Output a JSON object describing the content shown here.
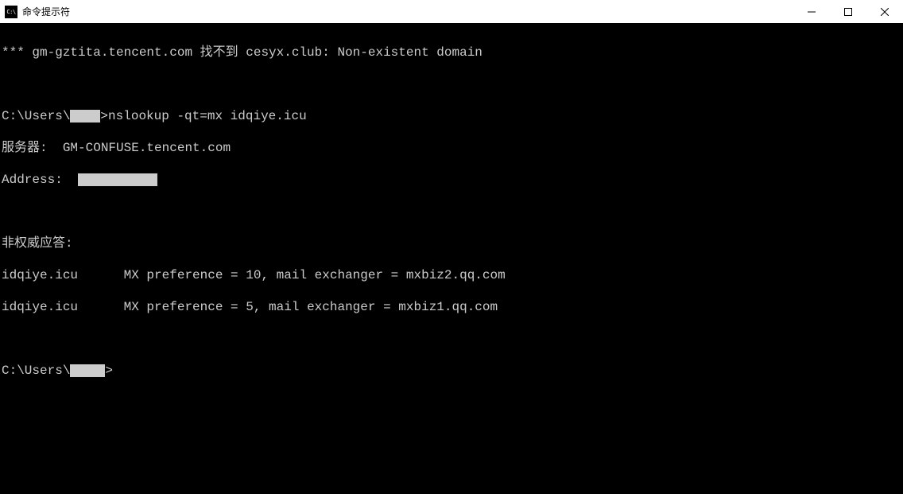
{
  "window": {
    "title": "命令提示符",
    "icon_text": "C:\\"
  },
  "terminal": {
    "line_error": "*** gm-gztita.tencent.com 找不到 cesyx.club: Non-existent domain",
    "prompt1_prefix": "C:\\Users\\",
    "prompt1_suffix": ">",
    "command1": "nslookup -qt=mx idqiye.icu",
    "server_label": "服务器:  ",
    "server_value": "GM-CONFUSE.tencent.com",
    "address_label": "Address:  ",
    "nonauth_label": "非权威应答:",
    "mx1": "idqiye.icu      MX preference = 10, mail exchanger = mxbiz2.qq.com",
    "mx2": "idqiye.icu      MX preference = 5, mail exchanger = mxbiz1.qq.com",
    "prompt2_prefix": "C:\\Users\\",
    "prompt2_suffix": ">"
  }
}
